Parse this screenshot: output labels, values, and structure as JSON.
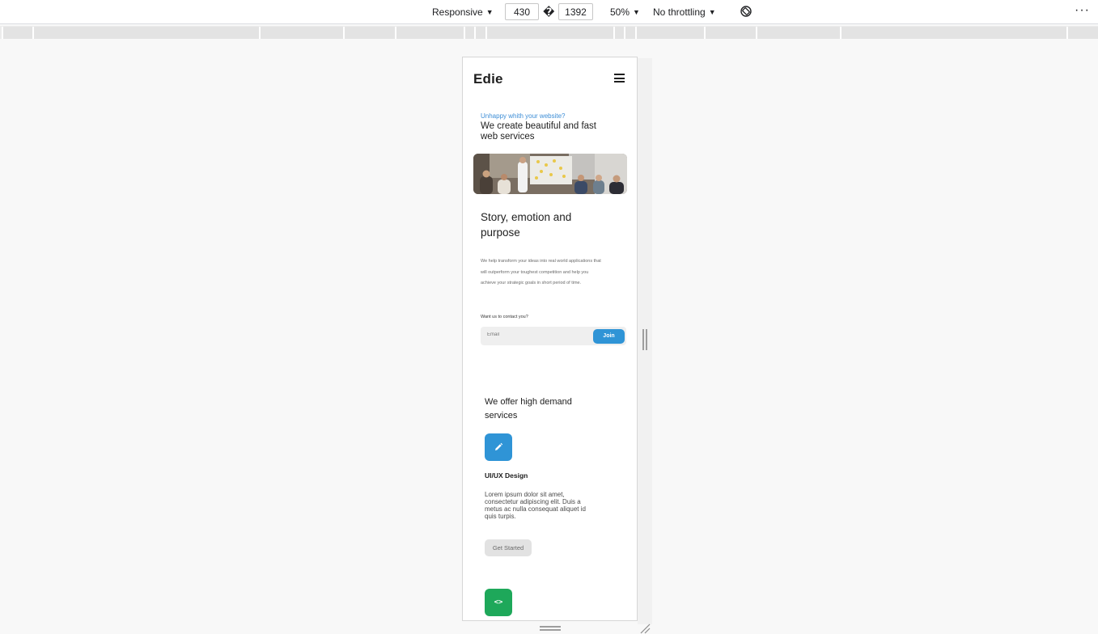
{
  "devtools": {
    "device_mode": "Responsive",
    "width": "430",
    "height": "1392",
    "times_glyph": "�",
    "zoom": "50%",
    "throttling": "No throttling",
    "more_glyph": "⋮",
    "caret": "▼"
  },
  "page": {
    "logo": "Edie",
    "hero": {
      "eyebrow": "Unhappy whith your website?",
      "title": "We create beautiful and fast web services"
    },
    "story": {
      "title": "Story, emotion and purpose",
      "text": "We help transform your ideas into real world applications that will outperform your toughest competition and help you achieve your strategic goals in short period of time."
    },
    "contact": {
      "label": "Want us to contact you?",
      "email_placeholder": "Email",
      "join_label": "Join"
    },
    "offer": {
      "title": "We offer high demand services"
    },
    "service": {
      "title": "UI/UX Design",
      "text": "Lorem ipsum dolor sit amet, consectetur adipiscing elit. Duis a metus ac nulla consequat aliquet id quis turpis.",
      "button_label": "Get Started",
      "next_icon_glyph": "<>"
    }
  },
  "colors": {
    "accent_blue": "#2f94d6",
    "accent_green": "#1ea85a",
    "eyebrow_blue": "#3c8dd6"
  }
}
